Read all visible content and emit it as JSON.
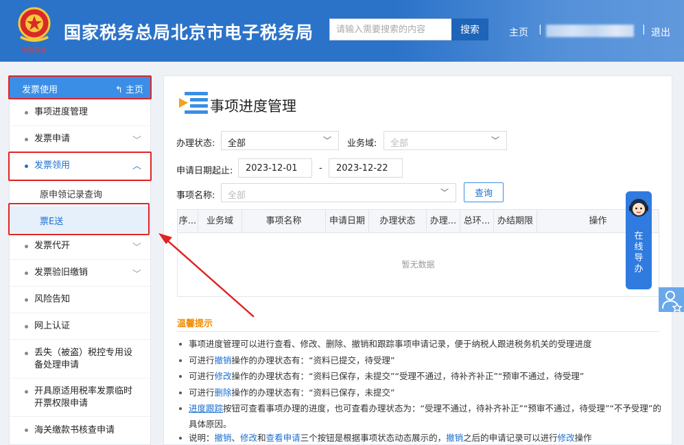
{
  "header": {
    "emblem_text": "中国税务",
    "title": "国家税务总局北京市电子税务局",
    "search_placeholder": "请输入需要搜索的内容",
    "search_button": "搜索",
    "home": "主页",
    "separator": "|",
    "logout": "退出"
  },
  "sidebar": {
    "section_title": "发票使用",
    "home_link": "主页",
    "items": [
      {
        "label": "事项进度管理"
      },
      {
        "label": "发票申请"
      },
      {
        "label": "发票领用"
      },
      {
        "label": "原申领记录查询"
      },
      {
        "label": "票E送"
      },
      {
        "label": "发票代开"
      },
      {
        "label": "发票验旧缴销"
      },
      {
        "label": "风险告知"
      },
      {
        "label": "网上认证"
      },
      {
        "label": "丢失（被盗）税控专用设备处理申请"
      },
      {
        "label": "开具原适用税率发票临时开票权限申请"
      },
      {
        "label": "海关缴款书核查申请"
      }
    ]
  },
  "main": {
    "page_title": "事项进度管理",
    "status_label": "办理状态:",
    "status_value": "全部",
    "domain_label": "业务域:",
    "domain_value": "全部",
    "date_label": "申请日期起止:",
    "date_from": "2023-12-01",
    "date_dash": "-",
    "date_to": "2023-12-22",
    "item_label": "事项名称:",
    "item_value": "全部",
    "query_button": "查询",
    "columns": [
      "序...",
      "业务域",
      "事项名称",
      "申请日期",
      "办理状态",
      "办理...",
      "总环...",
      "办结期限",
      "操作"
    ],
    "empty_text": "暂无数据",
    "tips_title": "温馨提示",
    "tips": {
      "t1": "事项进度管理可以进行查看、修改、删除、撤销和跟踪事项申请记录，便于纳税人跟进税务机关的受理进度",
      "t2a": "可进行",
      "t2b": "撤销",
      "t2c": "操作的办理状态有：“资料已提交，待受理”",
      "t3a": "可进行",
      "t3b": "修改",
      "t3c": "操作的办理状态有：“资料已保存，未提交”“受理不通过，待补齐补正”“预审不通过，待受理”",
      "t4a": "可进行",
      "t4b": "删除",
      "t4c": "操作的办理状态有：“资料已保存，未提交”",
      "t5a": "进度跟踪",
      "t5b": "按钮可查看事项办理的进度，也可查看办理状态为：“受理不通过，待补齐补正”“预审不通过，待受理”“不予受理”的具体原因。",
      "t6a": "说明：",
      "t6b": "撤销",
      "t6c": "、",
      "t6d": "修改",
      "t6e": "和",
      "t6f": "查看申请",
      "t6g": "三个按钮是根据事项状态动态展示的，",
      "t6h": "撤销",
      "t6i": "之后的申请记录可以进行",
      "t6j": "修改",
      "t6k": "操作"
    }
  },
  "guide": {
    "text": "在线导办"
  }
}
